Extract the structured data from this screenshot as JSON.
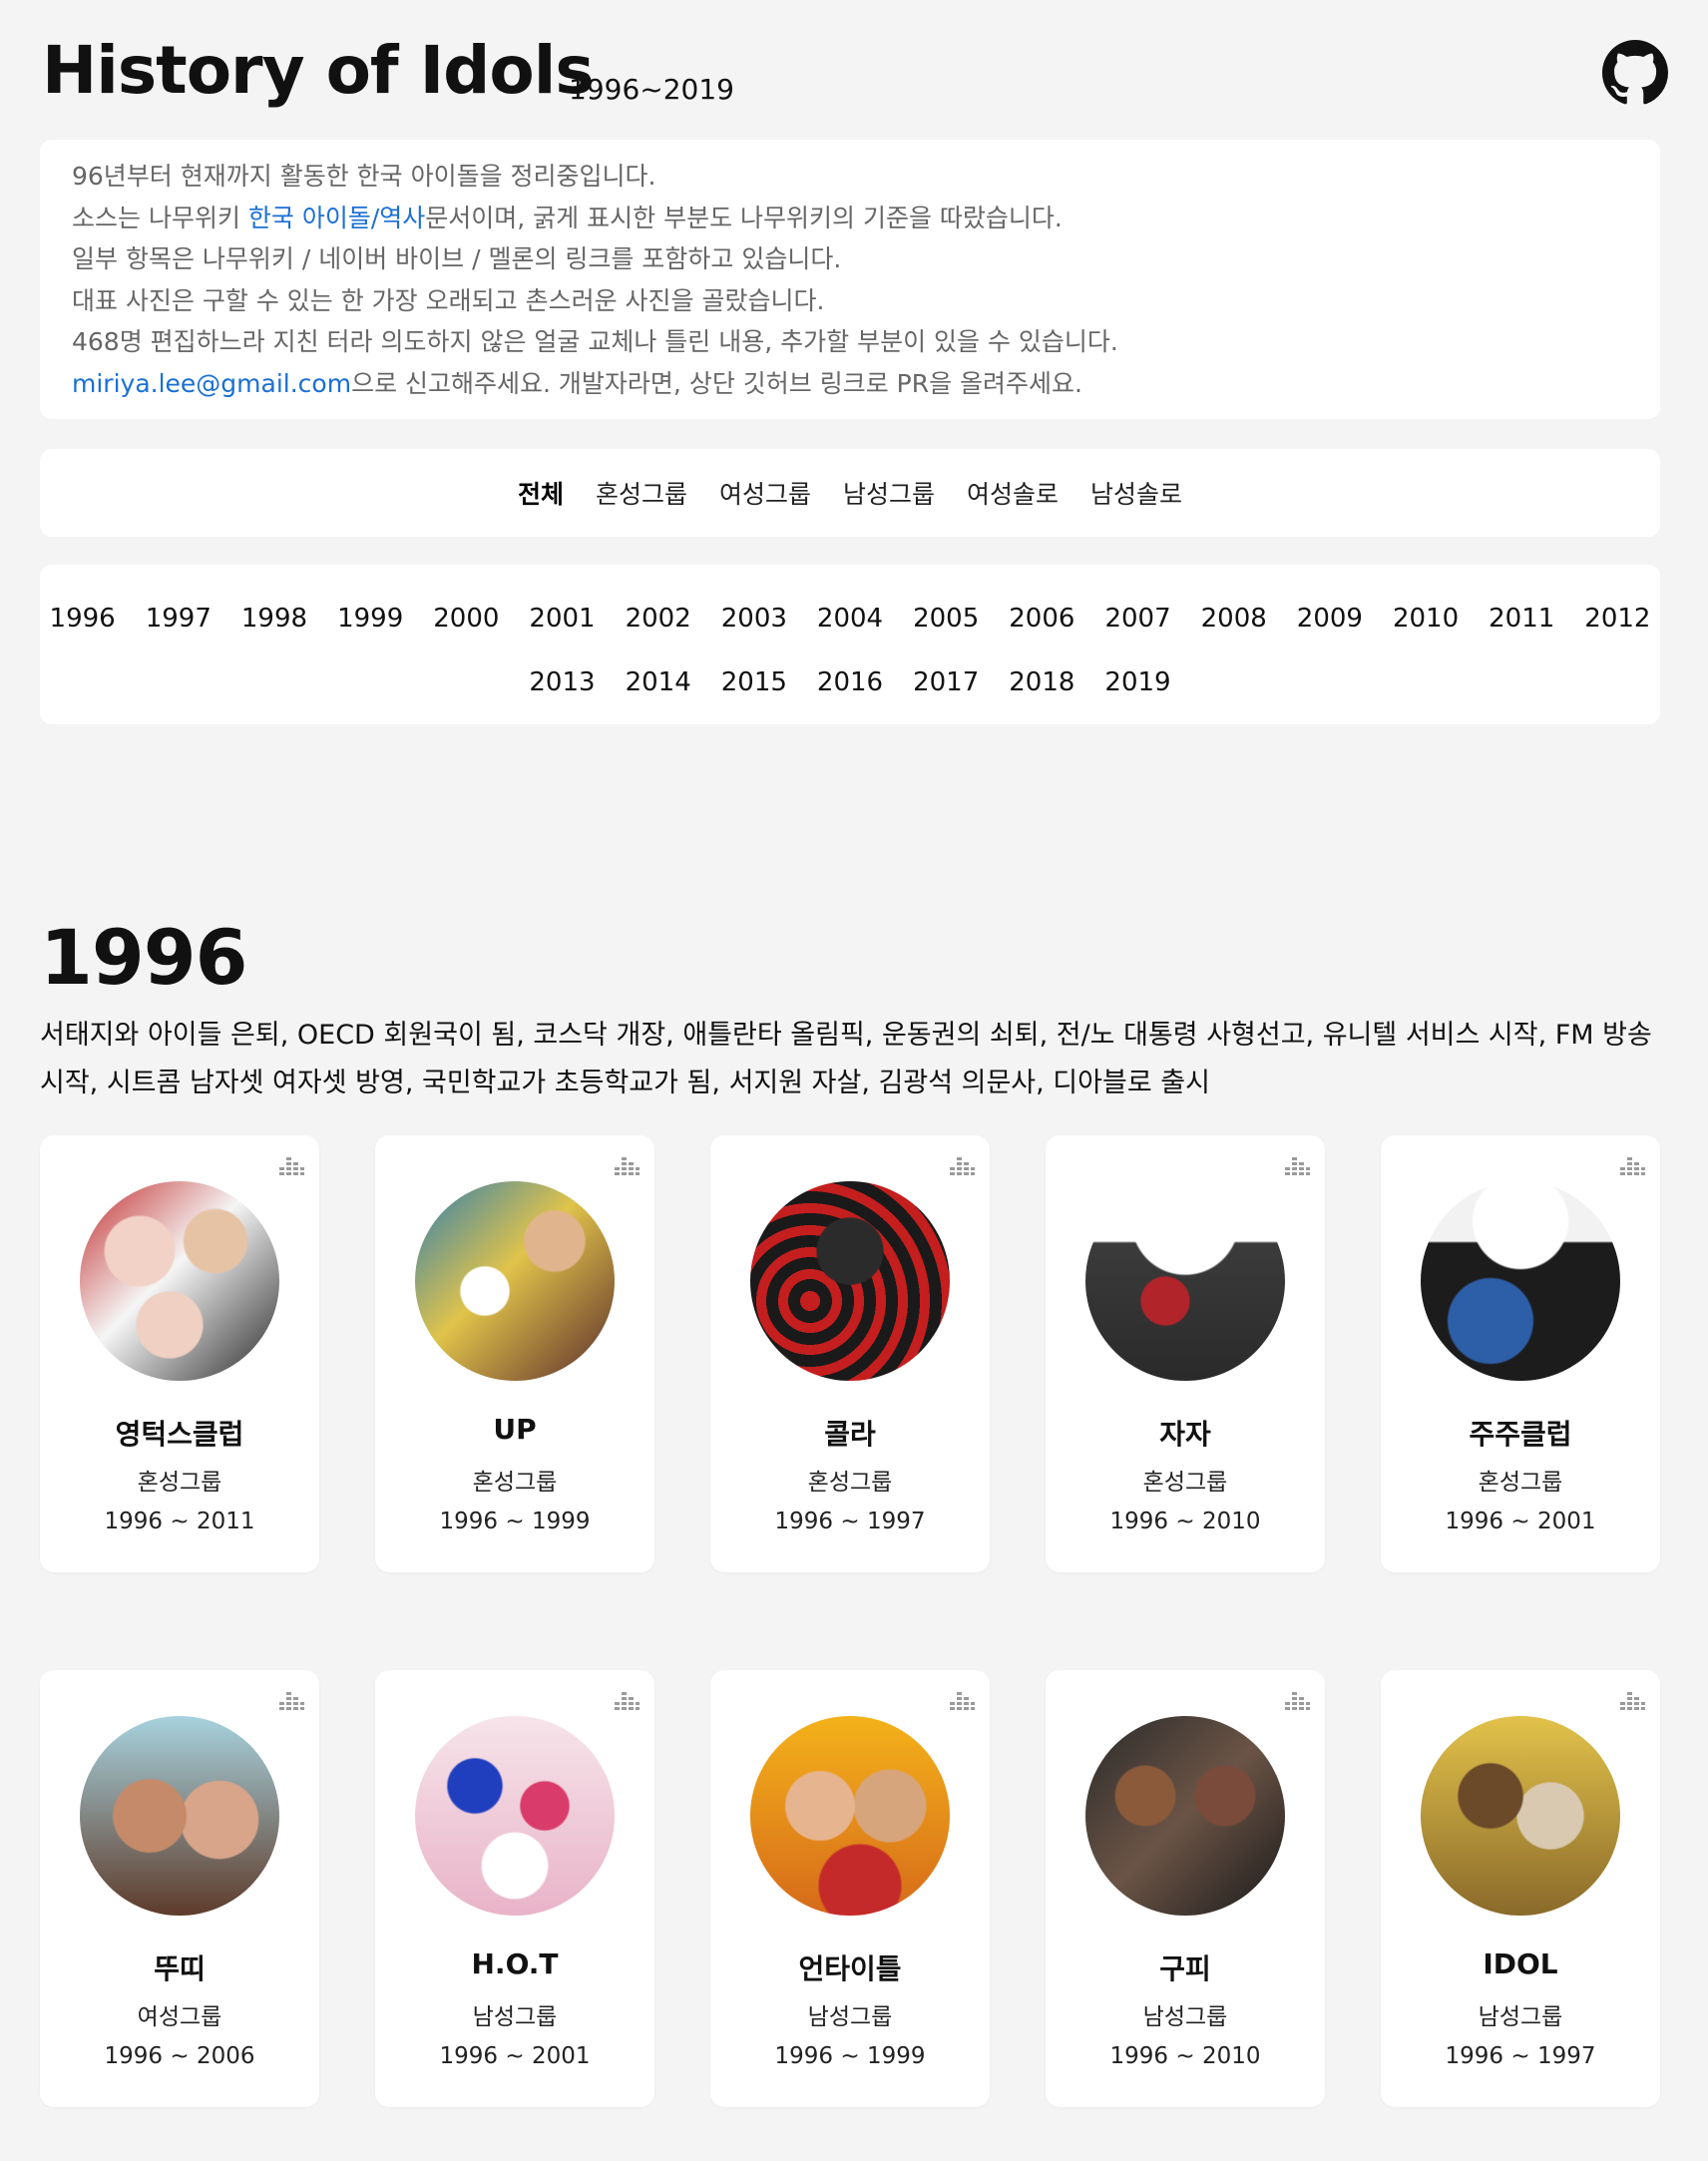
{
  "header": {
    "title": "History of Idols",
    "subtitle": "1996~2019",
    "github_icon": "github-icon"
  },
  "intro": {
    "line1": "96년부터 현재까지 활동한 한국 아이돌을 정리중입니다.",
    "line2_before": "소스는 나무위키 ",
    "line2_link": "한국 아이돌/역사",
    "line2_after": "문서이며, 굵게 표시한 부분도 나무위키의 기준을 따랐습니다.",
    "line3": "일부 항목은 나무위키 / 네이버 바이브 / 멜론의 링크를 포함하고 있습니다.",
    "line4": "대표 사진은 구할 수 있는 한 가장 오래되고 촌스러운 사진을 골랐습니다.",
    "line5": "468명 편집하느라 지친 터라 의도하지 않은 얼굴 교체나 틀린 내용, 추가할 부분이 있을 수 있습니다.",
    "line6_link": "miriya.lee@gmail.com",
    "line6_after": "으로 신고해주세요. 개발자라면, 상단 깃허브 링크로 PR을 올려주세요.",
    "link_color": "#1a6fd6"
  },
  "filters": {
    "all": "전체",
    "mixed": "혼성그룹",
    "female_group": "여성그룹",
    "male_group": "남성그룹",
    "female_solo": "여성솔로",
    "male_solo": "남성솔로"
  },
  "years": {
    "row1": [
      "1996",
      "1997",
      "1998",
      "1999",
      "2000",
      "2001",
      "2002",
      "2003",
      "2004",
      "2005",
      "2006",
      "2007",
      "2008",
      "2009",
      "2010",
      "2011",
      "2012"
    ],
    "row2": [
      "2013",
      "2014",
      "2015",
      "2016",
      "2017",
      "2018",
      "2019"
    ]
  },
  "section": {
    "year": "1996",
    "description": "서태지와 아이들 은퇴, OECD 회원국이 됨, 코스닥 개장, 애틀란타 올림픽, 운동권의 쇠퇴, 전/노 대통령 사형선고, 유니텔 서비스 시작, FM 방송 시작, 시트콤 남자셋 여자셋 방영, 국민학교가 초등학교가 됨, 서지원 자살, 김광석 의문사, 디아블로 출시"
  },
  "cards": [
    {
      "name": "영턱스클럽",
      "type": "혼성그룹",
      "period": "1996 ~ 2011",
      "icon": "melon-chart-icon"
    },
    {
      "name": "UP",
      "type": "혼성그룹",
      "period": "1996 ~ 1999",
      "icon": "melon-chart-icon"
    },
    {
      "name": "콜라",
      "type": "혼성그룹",
      "period": "1996 ~ 1997",
      "icon": "melon-chart-icon"
    },
    {
      "name": "자자",
      "type": "혼성그룹",
      "period": "1996 ~ 2010",
      "icon": "melon-chart-icon"
    },
    {
      "name": "주주클럽",
      "type": "혼성그룹",
      "period": "1996 ~ 2001",
      "icon": "melon-chart-icon"
    },
    {
      "name": "뚜띠",
      "type": "여성그룹",
      "period": "1996 ~ 2006",
      "icon": "melon-chart-icon"
    },
    {
      "name": "H.O.T",
      "type": "남성그룹",
      "period": "1996 ~ 2001",
      "icon": "melon-chart-icon"
    },
    {
      "name": "언타이틀",
      "type": "남성그룹",
      "period": "1996 ~ 1999",
      "icon": "melon-chart-icon"
    },
    {
      "name": "구피",
      "type": "남성그룹",
      "period": "1996 ~ 2010",
      "icon": "melon-chart-icon"
    },
    {
      "name": "IDOL",
      "type": "남성그룹",
      "period": "1996 ~ 1997",
      "icon": "melon-chart-icon"
    }
  ]
}
